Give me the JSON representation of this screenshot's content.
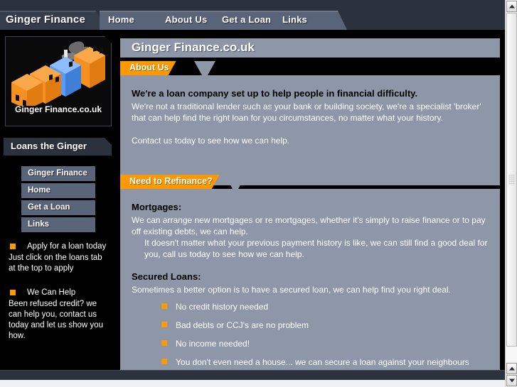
{
  "nav": {
    "brand_tab": "Ginger Finance",
    "tabs": [
      {
        "label": "Home"
      },
      {
        "label": "About Us"
      },
      {
        "label": "Get a Loan"
      },
      {
        "label": "Links"
      }
    ]
  },
  "sidebar": {
    "logo_caption": "Ginger Finance.co.uk",
    "tagline": "Loans the Ginger Way...",
    "menu": [
      {
        "label": "Ginger Finance"
      },
      {
        "label": "Home"
      },
      {
        "label": "Get a Loan"
      },
      {
        "label": "Links"
      }
    ],
    "promos": [
      {
        "heading": "Apply for a loan today",
        "body": "Just click on the loans tab at the top to apply"
      },
      {
        "heading": "We Can Help",
        "body": "Been refused credit? we can help you, contact us today and let us show you how."
      }
    ]
  },
  "main": {
    "page_title": "Ginger Finance.co.uk",
    "sections": [
      {
        "tab_label": "About Us",
        "lead": "We're a loan company set up to help people in financial difficulty.",
        "paragraph": "We're not a traditional lender such as your bank or building society, we're a specialist 'broker' that can help find the right loan for you circumstances, no matter what your history.",
        "closing": "Contact us today to see how we can help."
      },
      {
        "tab_label": "Need to Refinance?",
        "mortgages_heading": "Mortgages:",
        "mortgages_body": "We can arrange new mortgages or re mortgages, whether it's simply to raise finance or to pay off existing debts, we can help.",
        "mortgages_indent": "It doesn't matter what your previous payment history is like, we can still find a good deal for you, call us today to see how we can help.",
        "secured_heading": "Secured Loans:",
        "secured_body": "Sometimes a better option is to have a secured loan, we can help find you right deal.",
        "secured_list": [
          "No credit history needed",
          "Bad debts or CCJ's are no problem",
          "No income needed!",
          "You don't even need a house... we can secure a loan against your neighbours house."
        ]
      }
    ]
  },
  "colors": {
    "accent_orange": "#ff9900",
    "panel_grey": "#8d97a8",
    "tab_blue_grey": "#5a6478",
    "dark_navy": "#2b313d",
    "page_black": "#000000"
  },
  "scrollbar": {
    "up_arrow": "triangle-up",
    "down_arrow": "triangle-down"
  }
}
